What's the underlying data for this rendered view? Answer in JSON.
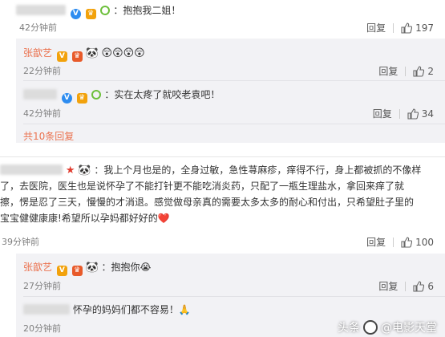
{
  "c1": {
    "text": "：抱抱我二姐！",
    "time": "42分钟前",
    "reply": "回复",
    "likes": "197"
  },
  "r1": {
    "name": "张歆艺",
    "text": "😲😲😲😲",
    "time": "22分钟前",
    "reply": "回复",
    "likes": "2"
  },
  "r2": {
    "text": "：实在太疼了就咬老袁吧！",
    "time": "42分钟前",
    "reply": "回复",
    "likes": "34"
  },
  "more_replies": "共10条回复",
  "c2": {
    "line1": "：我上个月也是的，全身过敏，急性荨麻疹，痒得不行，身上都被抓的不像样",
    "line2": "了，去医院，医生也是说怀孕了不能打针更不能吃消炎药，只配了一瓶生理盐水，拿回来痒了就",
    "line3": "擦，愣是忍了三天，慢慢的才消退。感觉做母亲真的需要太多太多的耐心和付出，只希望肚子里的",
    "line4": "宝宝健健康康!希望所以孕妈都好好的❤️",
    "time": "39分钟前",
    "reply": "回复",
    "likes": "100"
  },
  "r3": {
    "name": "张歆艺",
    "text": "：抱抱你😭",
    "time": "27分钟前",
    "reply": "回复",
    "likes": "6"
  },
  "r4": {
    "text": "怀孕的妈妈们都不容易！🙏",
    "time": "20分钟前"
  },
  "watermark": {
    "prefix": "头条",
    "handle": "@电影天堂"
  },
  "icons": {
    "reply": "reply-link",
    "like": "thumbs-up-icon",
    "vip": "vip-crown-icon",
    "verified": "verified-v-icon",
    "panda": "panda-icon"
  },
  "colors": {
    "name": "#eb7350",
    "link": "#eb7350",
    "reply_bg": "#f2f2f5",
    "heart": "#e0245e"
  }
}
